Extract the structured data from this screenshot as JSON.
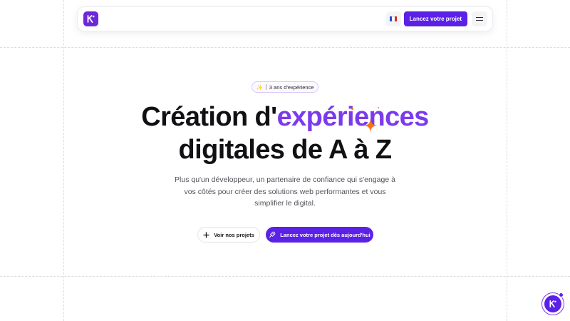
{
  "nav": {
    "logo_icon": "brand-logo-icon",
    "language_flag": "fr-flag-icon",
    "cta_label": "Lancez votre projet",
    "menu_icon": "hamburger-menu-icon"
  },
  "hero": {
    "badge_emoji": "✨",
    "badge_text": "3 ans d'expérience",
    "headline_part1": "Création d'",
    "headline_accent": "expériences",
    "headline_line2": "digitales de A à Z",
    "subtitle": "Plus qu'un développeur, un partenaire de confiance qui s'engage à vos côtés pour créer des solutions web performantes et vous simplifier le digital.",
    "secondary_button": "Voir nos projets",
    "primary_button": "Lancez votre projet dès aujourd'hui"
  },
  "floating": {
    "icon": "chat-avatar-icon"
  },
  "colors": {
    "brand": "#5b21e6",
    "accent": "#7c3aed",
    "sparkle": "#f97316"
  }
}
